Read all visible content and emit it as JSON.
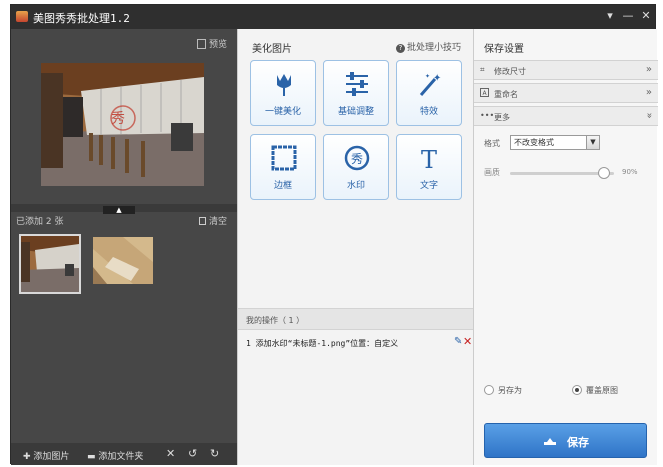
{
  "window": {
    "title": "美图秀秀批处理1.2",
    "controls": [
      "feedback-icon",
      "minimize-icon",
      "close-icon"
    ]
  },
  "left_panel": {
    "preview_label": "预览",
    "added_info": "已添加 2 张",
    "clear_label": "清空",
    "bottom": {
      "add_image": "添加图片",
      "add_folder": "添加文件夹"
    }
  },
  "middle_panel": {
    "section_title": "美化图片",
    "tips_label": "批处理小技巧",
    "tools": [
      {
        "label": "一键美化",
        "icon": "tulip-icon"
      },
      {
        "label": "基础调整",
        "icon": "sliders-icon"
      },
      {
        "label": "特效",
        "icon": "magic-wand-icon"
      },
      {
        "label": "边框",
        "icon": "frame-icon"
      },
      {
        "label": "水印",
        "icon": "watermark-stamp-icon"
      },
      {
        "label": "文字",
        "icon": "text-t-icon"
      }
    ],
    "my_ops_label": "我的操作（ 1 ）",
    "operation": "1  添加水印“未标题-1.png”位置：自定义"
  },
  "right_panel": {
    "section_title": "保存设置",
    "accordion": [
      {
        "label": "修改尺寸",
        "icon": "crop-icon",
        "state": "collapsed"
      },
      {
        "label": "重命名",
        "icon": "rename-icon",
        "state": "collapsed"
      },
      {
        "label": "更多",
        "icon": "more-dots-icon",
        "state": "expanded"
      }
    ],
    "format_label": "格式",
    "format_value": "不改变格式",
    "quality_label": "画质",
    "quality_value": "90%",
    "quality_level": 0.9,
    "save_as_label": "另存为",
    "overwrite_label": "覆盖原图",
    "selected_option": "overwrite",
    "save_button": "保存"
  }
}
